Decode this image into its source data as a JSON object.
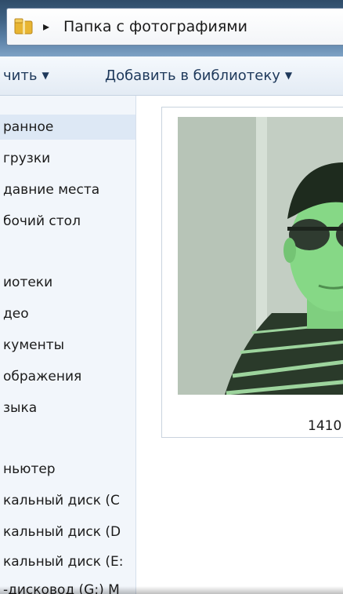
{
  "address": {
    "breadcrumb_arrow": "▸",
    "path": "Папка с фотографиями"
  },
  "toolbar": {
    "left_button": "чить",
    "add_to_library": "Добавить в библиотеку",
    "caret": "▼"
  },
  "nav": {
    "items": [
      "ранное",
      "грузки",
      "давние места",
      "бочий стол",
      "",
      "иотеки",
      "део",
      "кументы",
      "ображения",
      "зыка",
      "",
      "ньютер",
      "кальный диск (C",
      "кальный диск (D",
      "кальный диск (E:",
      "-дисковод (G:) М"
    ]
  },
  "content": {
    "thumbnail_label": "1410"
  },
  "colors": {
    "accent": "#1e395b",
    "nav_background": "#f2f6fb",
    "selection": "#dde8f5",
    "photo_tint": "#8fd68f"
  }
}
